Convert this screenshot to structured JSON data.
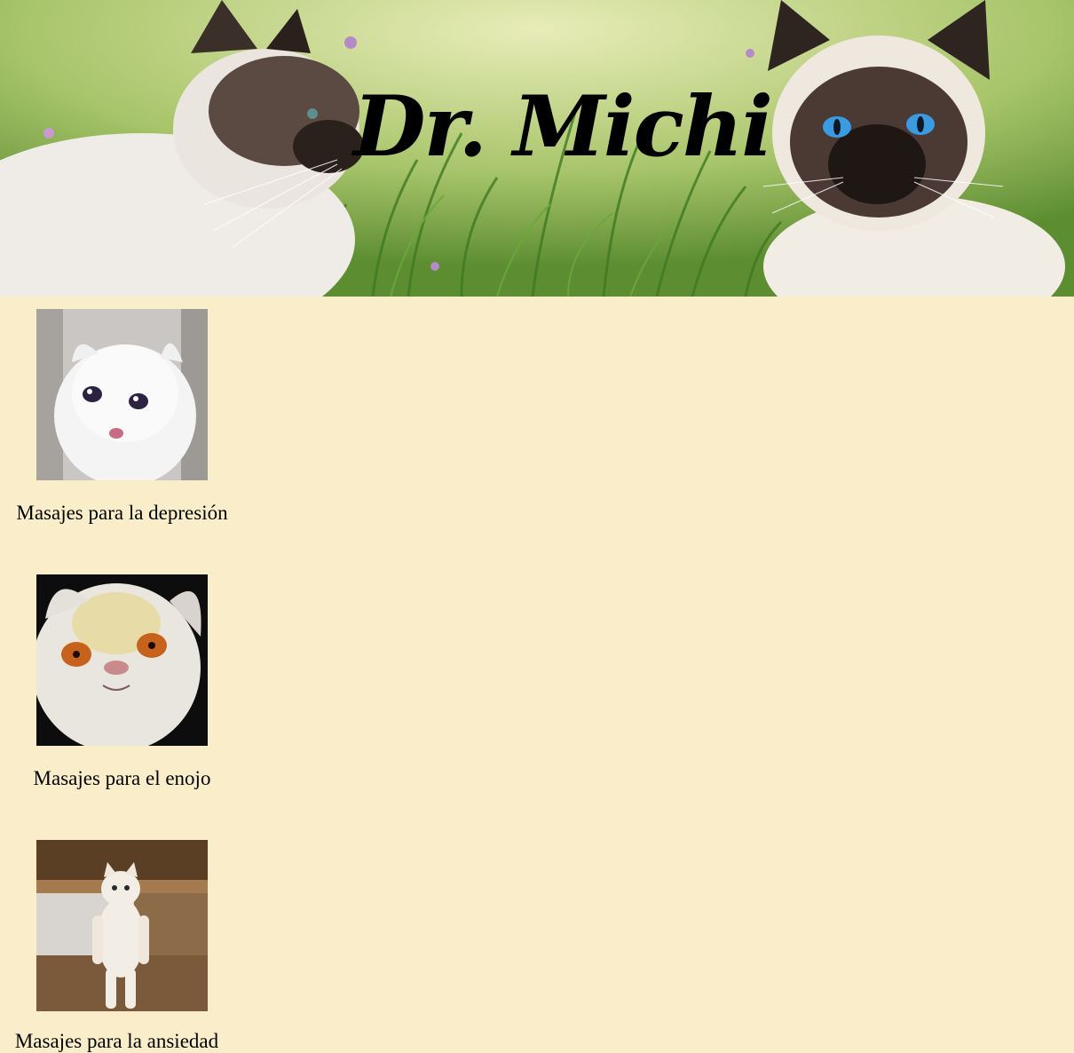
{
  "header": {
    "title": "Dr. Michi"
  },
  "services": [
    {
      "caption": "Masajes para la depresión",
      "image": "crying-white-cat"
    },
    {
      "caption": "Masajes para el enojo",
      "image": "angry-persian-cat"
    },
    {
      "caption": "Masajes para la ansiedad",
      "image": "standing-white-cat"
    }
  ],
  "colors": {
    "background": "#faeeca",
    "text": "#000000"
  }
}
